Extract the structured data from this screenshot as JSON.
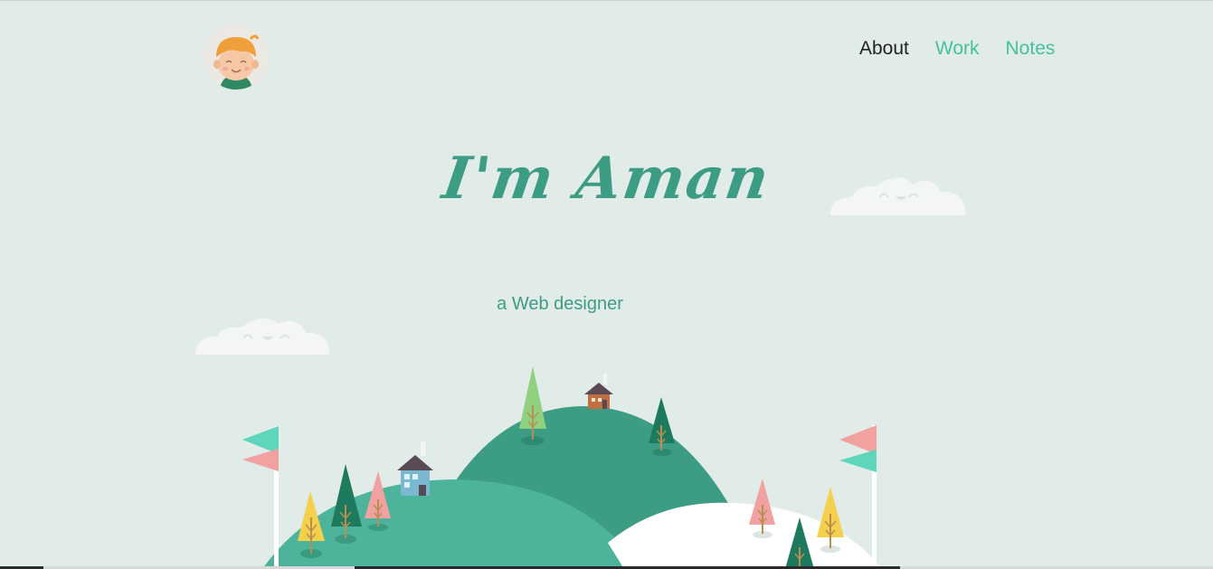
{
  "header": {
    "avatar_alt": "Aman avatar",
    "nav": [
      {
        "label": "About",
        "active": true
      },
      {
        "label": "Work",
        "active": false
      },
      {
        "label": "Notes",
        "active": false
      }
    ]
  },
  "hero": {
    "title": "I'm Aman",
    "subtitle": "a Web designer"
  },
  "colors": {
    "background": "#e1ebe7",
    "accent": "#45c19d",
    "title": "#3d9c84",
    "hill_dark": "#3d9c84",
    "hill_light": "#4db39b",
    "hill_white": "#ffffff",
    "flag_teal": "#5dd6bb",
    "flag_pink": "#f2a1a1"
  }
}
